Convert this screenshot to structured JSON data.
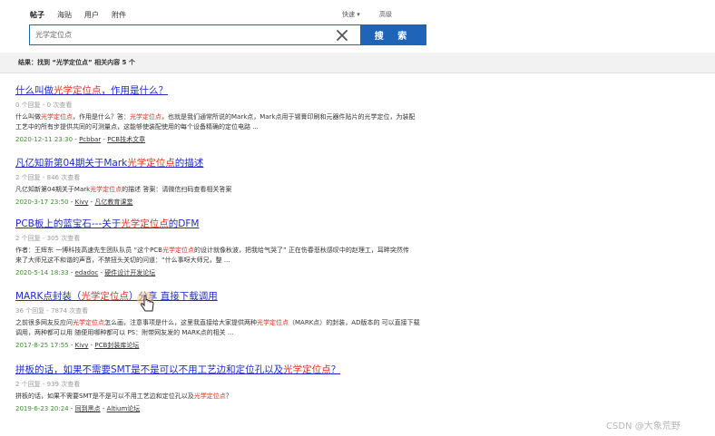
{
  "tabs": [
    "帖子",
    "海贴",
    "用户",
    "附件"
  ],
  "search": {
    "value": "光学定位点",
    "button": "搜 索",
    "quick": "快速",
    "advanced": "高级"
  },
  "result_summary": "结果：找到 “光学定位点” 相关内容 5 个",
  "results": [
    {
      "title_pre": "什么叫做",
      "title_hl": "光学定位点",
      "title_post": "，作用是什么？",
      "meta": "0 个回复 - 0 次查看",
      "snippet_lines": [
        [
          "什么叫做",
          "光学定位点",
          "，作用是什么？答：",
          "光学定位点",
          "，也就是我们通常所说的Mark点，Mark点用于锡膏印刷和元器件贴片的光学定位，为装配"
        ],
        [
          "工艺中的所有步提供共同的可测量点，这能够使装配使用的每个设备精确的定位电路 ..."
        ]
      ],
      "date": "2020-12-11 23:30",
      "author": "Pcbbar",
      "forum": "PCB技术文章"
    },
    {
      "title_pre": "凡亿知新第04期关于Mark",
      "title_hl": "光学定位点",
      "title_post": "的描述",
      "meta": "2 个回复 - 846 次查看",
      "snippet_lines": [
        [
          "凡亿知新第04期关于Mark",
          "光学定位点",
          "的描述 答案：请微信扫码查看相关答案"
        ]
      ],
      "date": "2020-3-17 23:50",
      "author": "Kivy",
      "forum": "凡亿教育课堂"
    },
    {
      "title_pre": "PCB板上的蓝宝石---关于",
      "title_hl": "光学定位点",
      "title_post": "的DFM",
      "meta": "2 个回复 - 305 次查看",
      "snippet_lines": [
        [
          "作者：王辉东 一博科技高速先生团队队员 “这个PCB",
          "光学定位点",
          "的设计就像秋波，把我给气哭了” 正在伤春悲秋感叹中的赵理工，耳畔突然传"
        ],
        [
          "来了大师兄这不和谐的声音，不禁扭头关切的问道：“什么事呀大师兄，整 ..."
        ]
      ],
      "date": "2020-5-14 18:33",
      "author": "edadoc",
      "forum": "硬件设计开发论坛"
    },
    {
      "title_pre": "MARK点封装（",
      "title_hl": "光学定位点",
      "title_post": "）分享 直接下载调用",
      "meta": "36 个回复 - 7874 次查看",
      "snippet_lines": [
        [
          "之前很多网友反应问",
          "光学定位点",
          "怎么画，注意事项是什么，这里我直接给大家提供两种",
          "光学定位点",
          "（MARK点）的封装，AD版本的 可以直接下载"
        ],
        [
          "调用，两种都可以用 随便用哪种都可以 PS：附带网友发的 MARK点的相关 ..."
        ]
      ],
      "date": "2017-8-25 17:55",
      "author": "Kivy",
      "forum": "PCB封装库论坛"
    },
    {
      "title_pre": "拼板的话，如果不需要SMT是不是可以不用工艺边和定位孔以及",
      "title_hl": "光学定位点",
      "title_post": "？",
      "meta": "2 个回复 - 939 次查看",
      "snippet_lines": [
        [
          "拼板的话，如果不需要SMT是不是可以不用工艺边和定位孔以及",
          "光学定位点",
          "？"
        ]
      ],
      "date": "2019-6-23 20:24",
      "author": "同到黑点",
      "forum": "Altium论坛"
    }
  ],
  "watermark": "CSDN @大象荒野"
}
